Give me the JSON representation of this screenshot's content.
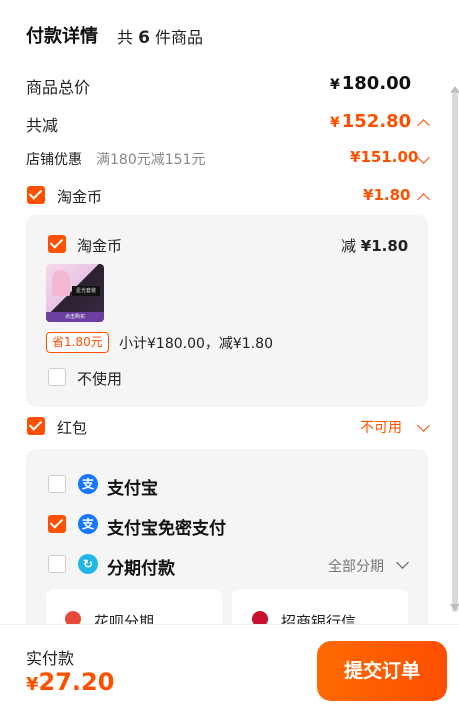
{
  "header": {
    "title": "付款详情",
    "count_prefix": "共",
    "count": "6",
    "count_suffix": "件商品"
  },
  "summary": {
    "total_label": "商品总价",
    "total_yen": "¥",
    "total_value": "180.00",
    "discount_label": "共减",
    "discount_yen": "¥",
    "discount_value": "152.80"
  },
  "store": {
    "label": "店铺优惠",
    "desc": "满180元减151元",
    "yen": "¥",
    "value": "151.00"
  },
  "coin": {
    "label": "淘金币",
    "yen": "¥",
    "value": "1.80",
    "panel": {
      "item_label": "淘金币",
      "reduce_prefix": "减",
      "reduce_value": "¥1.80",
      "badge": "省1.80元",
      "subtotal": "小计¥180.00，减¥1.80",
      "no_use_label": "不使用",
      "thumb_tag": "星光套装",
      "thumb_caption": "点击购买"
    }
  },
  "redpacket": {
    "label": "红包",
    "status": "不可用"
  },
  "payment": {
    "alipay_label": "支付宝",
    "alipay_nopwd_label": "支付宝免密支付",
    "installment_label": "分期付款",
    "installment_option": "全部分期",
    "cards": [
      {
        "label": "花呗分期"
      },
      {
        "label": "招商银行信"
      }
    ],
    "alipay_icon_glyph": "支",
    "installment_icon_glyph": "↻"
  },
  "footer": {
    "paid_label": "实付款",
    "paid_yen": "¥",
    "paid_value": "27.20",
    "submit_label": "提交订单"
  },
  "colors": {
    "accent": "#ff5000",
    "alipay_blue": "#1677ff",
    "panel_bg": "#f5f5f5"
  }
}
